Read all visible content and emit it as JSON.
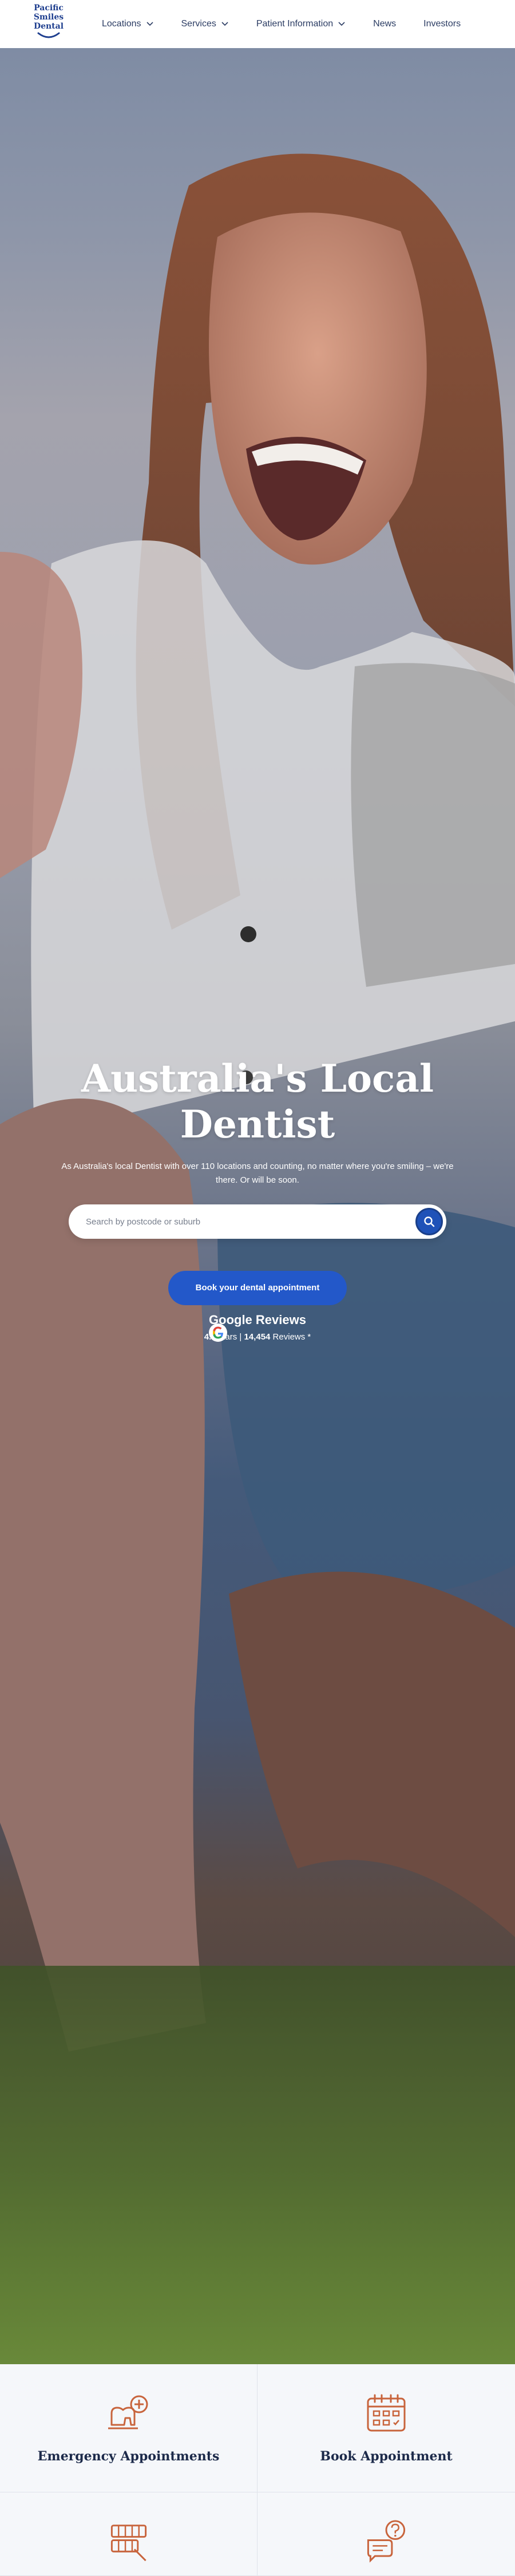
{
  "brand": {
    "logo_line1": "Pacific",
    "logo_line2": "Smiles",
    "logo_line3": "Dental"
  },
  "nav": {
    "items": [
      {
        "label": "Locations",
        "has_dropdown": true
      },
      {
        "label": "Services",
        "has_dropdown": true
      },
      {
        "label": "Patient Information",
        "has_dropdown": true
      },
      {
        "label": "News",
        "has_dropdown": false
      },
      {
        "label": "Investors",
        "has_dropdown": false
      }
    ]
  },
  "hero": {
    "title_line1": "Australia's Local",
    "title_line2": "Dentist",
    "subtitle": "As Australia's local Dentist with over 110 locations and counting, no matter where you're smiling – we're there. Or will be soon.",
    "search_placeholder": "Search by postcode or suburb",
    "book_button": "Book your dental appointment",
    "reviews_title": "Google Reviews",
    "rating": "4.8",
    "rating_suffix": " stars | ",
    "review_count": "14,454",
    "reviews_suffix": " Reviews *"
  },
  "cards": [
    {
      "title": "Emergency Appointments",
      "icon": "emergency-tooth-icon"
    },
    {
      "title": "Book Appointment",
      "icon": "calendar-icon"
    },
    {
      "title": "",
      "icon": "teeth-brace-icon"
    },
    {
      "title": "",
      "icon": "question-chat-icon"
    }
  ],
  "colors": {
    "primary": "#2358c9",
    "navy": "#1c2a4a",
    "icon_accent": "#c8643c",
    "card_bg": "#f5f7fa"
  }
}
